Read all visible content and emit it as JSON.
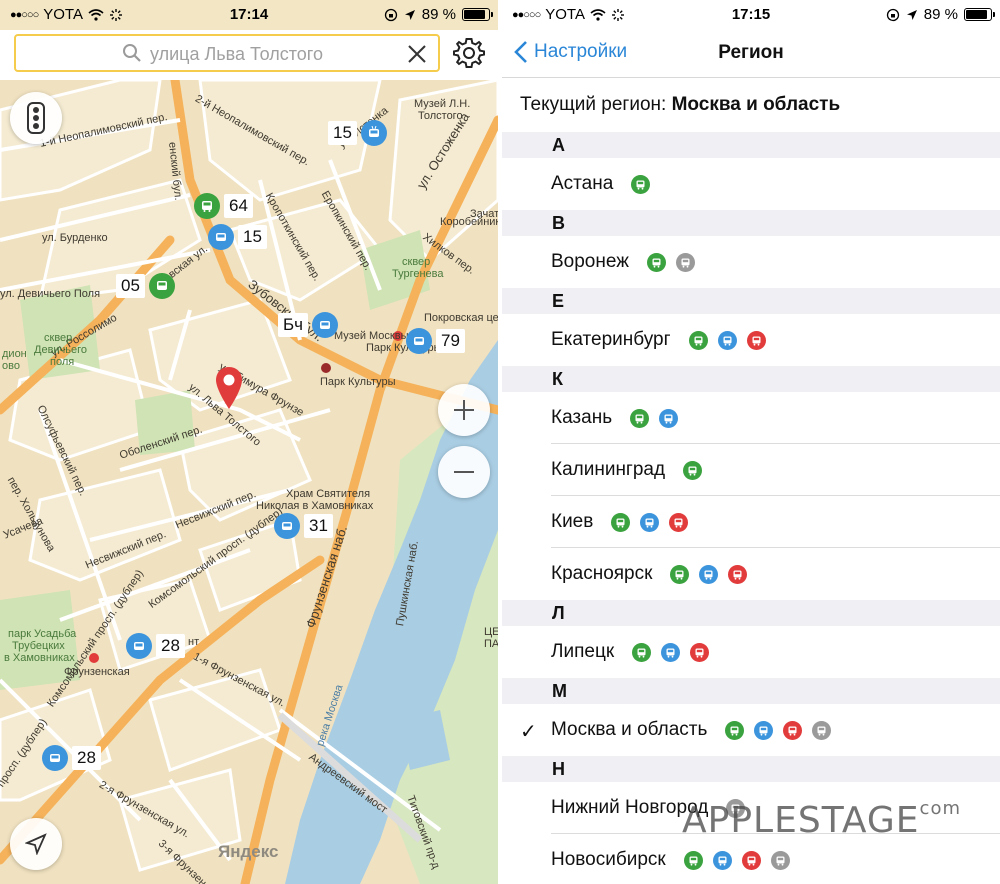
{
  "left_status": {
    "carrier": "YOTA",
    "time": "17:14",
    "battery": "89 %"
  },
  "right_status": {
    "carrier": "YOTA",
    "time": "17:15",
    "battery": "89 %"
  },
  "map": {
    "search_text": "улица Льва Толстого",
    "icons": [
      "search-icon",
      "clear-icon",
      "gear-icon",
      "traffic-light-icon",
      "zoom-in-icon",
      "zoom-out-icon",
      "locate-icon"
    ],
    "stops": [
      {
        "number": "15",
        "type": "trolleybus"
      },
      {
        "number": "64",
        "type": "bus"
      },
      {
        "number": "15",
        "type": "trolleybus"
      },
      {
        "number": "05",
        "type": "bus"
      },
      {
        "number": "Бч",
        "type": "trolleybus"
      },
      {
        "number": "79",
        "type": "trolleybus"
      },
      {
        "number": "31",
        "type": "trolleybus"
      },
      {
        "number": "28",
        "type": "trolleybus"
      },
      {
        "number": "28",
        "type": "trolleybus"
      }
    ],
    "labels": {
      "enskiy_bul": "енский бул.",
      "neopalimovsky1": "1-й Неопалимовский пер.",
      "neopalimovsky2": "2-й Неопалимовский пер.",
      "burdenko": "ул. Бурденко",
      "devichye_polya": "ул. Девичьего Поля",
      "skaya_ul": "вская ул.",
      "zubovsky": "Зубовский бул.",
      "rossolimo": "ул. Россолимо",
      "timura_frunze": "ул. Тимура Фрунзе",
      "lva_tolstogo": "ул. Льва Толстого",
      "olsufyevsky": "Олсуфьевский пер.",
      "obolensky": "Оболенский пер.",
      "kholzunova": "пер. Хользунова",
      "usacheva": "Усачева",
      "nesvizhsky1": "Несвижский пер.",
      "nesvizhsky2": "Несвижский пер.",
      "komsomolsky": "Комсомольский просп. (дублер)",
      "komsomolsky2": "Комсомольский просп. (дублер)",
      "komsomolsky3": "просп. (дублер)",
      "frunzenskaya1": "1-я Фрунзенская ул.",
      "frunzenskaya2": "2-я Фрунзенская ул.",
      "frunzenskaya3": "3-я Фрунзенская ул.",
      "frunzenskaya_nab": "Фрунзенская наб.",
      "pushkinskaya_nab": "Пушкинская наб.",
      "reka_moskva": "река Москва",
      "andreevsky_most": "Андреевский мост",
      "titovsky": "Титовский пр-д",
      "ostozhenka": "ул. Остоженка",
      "yeropkinsky": "Еропкинский пер.",
      "khilkov": "Хилков пер.",
      "korobeynikov": "Коробейников",
      "zachat": "Зачат",
      "kropotkinsky": "Кропоткинский пер.",
      "ul_tenka": "ул. Истенка",
      "muzei": "Музей Л.Н.",
      "muzei2": "Толстого",
      "skver_turgeneva": "сквер",
      "skver_turgeneva2": "Тургенева",
      "pokrovskaya": "Покровская церковь",
      "muzei_moskvy": "Музей Москвы",
      "park_kult1": "Парк Культуры",
      "park_kult2": "Парк Культуры",
      "khram": "Храм Святителя",
      "khram2": "Николая в Хамовниках",
      "skver_dev": "сквер",
      "skver_dev2": "Девичьего",
      "skver_dev3": "поля",
      "park_usadba": "парк Усадьба",
      "park_usadba2": "Трубецких",
      "park_usadba3": "в Хамовниках",
      "frunzenskaya_metro": "Фрунзенская",
      "dion": "дион",
      "ovo": "ово",
      "nt": "нт",
      "ts": "ЦЕ",
      "pa": "ПА",
      "yandex": "Яндекс"
    }
  },
  "settings": {
    "back_label": "Настройки",
    "title": "Регион",
    "current_label": "Текущий регион:",
    "current_value": "Москва и область",
    "sections": [
      {
        "letter": "А",
        "rows": [
          {
            "name": "Астана",
            "icons": [
              "bus"
            ],
            "checked": false
          }
        ]
      },
      {
        "letter": "В",
        "rows": [
          {
            "name": "Воронеж",
            "icons": [
              "bus",
              "minibus"
            ],
            "checked": false
          }
        ]
      },
      {
        "letter": "Е",
        "rows": [
          {
            "name": "Екатеринбург",
            "icons": [
              "bus",
              "trolleybus",
              "tram"
            ],
            "checked": false
          }
        ]
      },
      {
        "letter": "К",
        "rows": [
          {
            "name": "Казань",
            "icons": [
              "bus",
              "trolleybus"
            ],
            "checked": false
          },
          {
            "name": "Калининград",
            "icons": [
              "bus"
            ],
            "checked": false
          },
          {
            "name": "Киев",
            "icons": [
              "bus",
              "trolleybus",
              "tram"
            ],
            "checked": false
          },
          {
            "name": "Красноярск",
            "icons": [
              "bus",
              "trolleybus",
              "tram"
            ],
            "checked": false
          }
        ]
      },
      {
        "letter": "Л",
        "rows": [
          {
            "name": "Липецк",
            "icons": [
              "bus",
              "trolleybus",
              "tram"
            ],
            "checked": false
          }
        ]
      },
      {
        "letter": "М",
        "rows": [
          {
            "name": "Москва и область",
            "icons": [
              "bus",
              "trolleybus",
              "tram",
              "minibus"
            ],
            "checked": true
          }
        ]
      },
      {
        "letter": "Н",
        "rows": [
          {
            "name": "Нижний Новгород",
            "icons": [
              "minibus"
            ],
            "checked": false
          },
          {
            "name": "Новосибирск",
            "icons": [
              "bus",
              "trolleybus",
              "tram",
              "minibus"
            ],
            "checked": false
          }
        ]
      }
    ],
    "check_mark": "✓"
  },
  "watermark": {
    "apple": "APPLE",
    "stage": "STAGE",
    "com": "com"
  },
  "colors": {
    "bus": "#3aa23e",
    "trolleybus": "#3c94dc",
    "tram": "#e23b3b",
    "minibus": "#9a9a9a",
    "accent": "#2a86d6",
    "search_border": "#f5cc4b"
  }
}
